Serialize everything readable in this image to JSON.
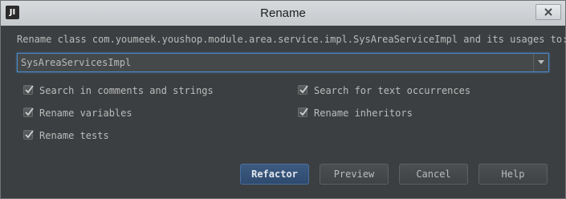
{
  "window": {
    "title": "Rename",
    "app_icon_text": "JI"
  },
  "prompt": {
    "text": "Rename class com.youmeek.youshop.module.area.service.impl.SysAreaServiceImpl and its usages to:"
  },
  "name_field": {
    "value": "SysAreaServicesImpl"
  },
  "options": {
    "search_comments": {
      "label": "Search in comments and strings",
      "checked": true
    },
    "search_text": {
      "label": "Search for text occurrences",
      "checked": true
    },
    "rename_variables": {
      "label": "Rename variables",
      "checked": true
    },
    "rename_inheritors": {
      "label": "Rename inheritors",
      "checked": true
    },
    "rename_tests": {
      "label": "Rename tests",
      "checked": true
    }
  },
  "buttons": {
    "refactor": "Refactor",
    "preview": "Preview",
    "cancel": "Cancel",
    "help": "Help"
  },
  "colors": {
    "background": "#3c3f41",
    "text": "#bbbbbb",
    "focus_border": "#4a88c7",
    "default_button": "#365880"
  }
}
